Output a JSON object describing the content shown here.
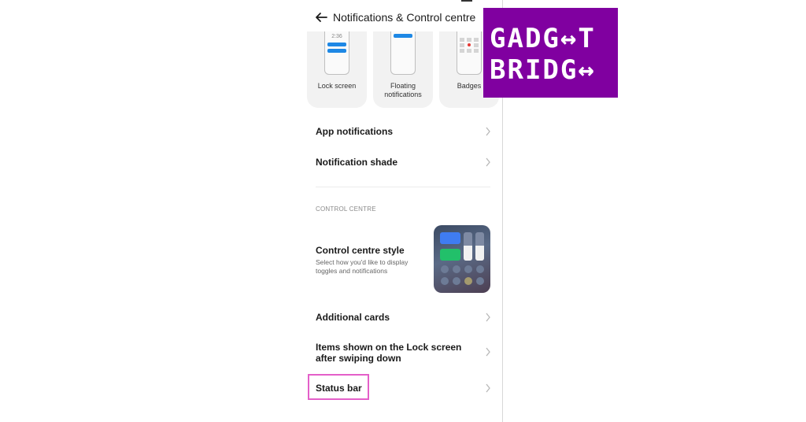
{
  "header": {
    "title": "Notifications & Control centre"
  },
  "style_cards": [
    {
      "label": "Lock screen",
      "time": "2:36"
    },
    {
      "label": "Floating notifications"
    },
    {
      "label": "Badges"
    }
  ],
  "list": {
    "app_notifications": "App notifications",
    "notification_shade": "Notification shade"
  },
  "control_centre": {
    "section_title": "CONTROL CENTRE",
    "style_title": "Control centre style",
    "style_subtitle": "Select how you'd like to display toggles and notifications",
    "additional_cards": "Additional cards",
    "lock_screen_items": "Items shown on the Lock screen after swiping down",
    "status_bar": "Status bar"
  },
  "logo": {
    "line1": "GADG↔T",
    "line2": "BRIDG↔"
  },
  "colors": {
    "accent_blue": "#1e88e5",
    "highlight": "#e45fc9",
    "logo_bg": "#8000a0"
  }
}
